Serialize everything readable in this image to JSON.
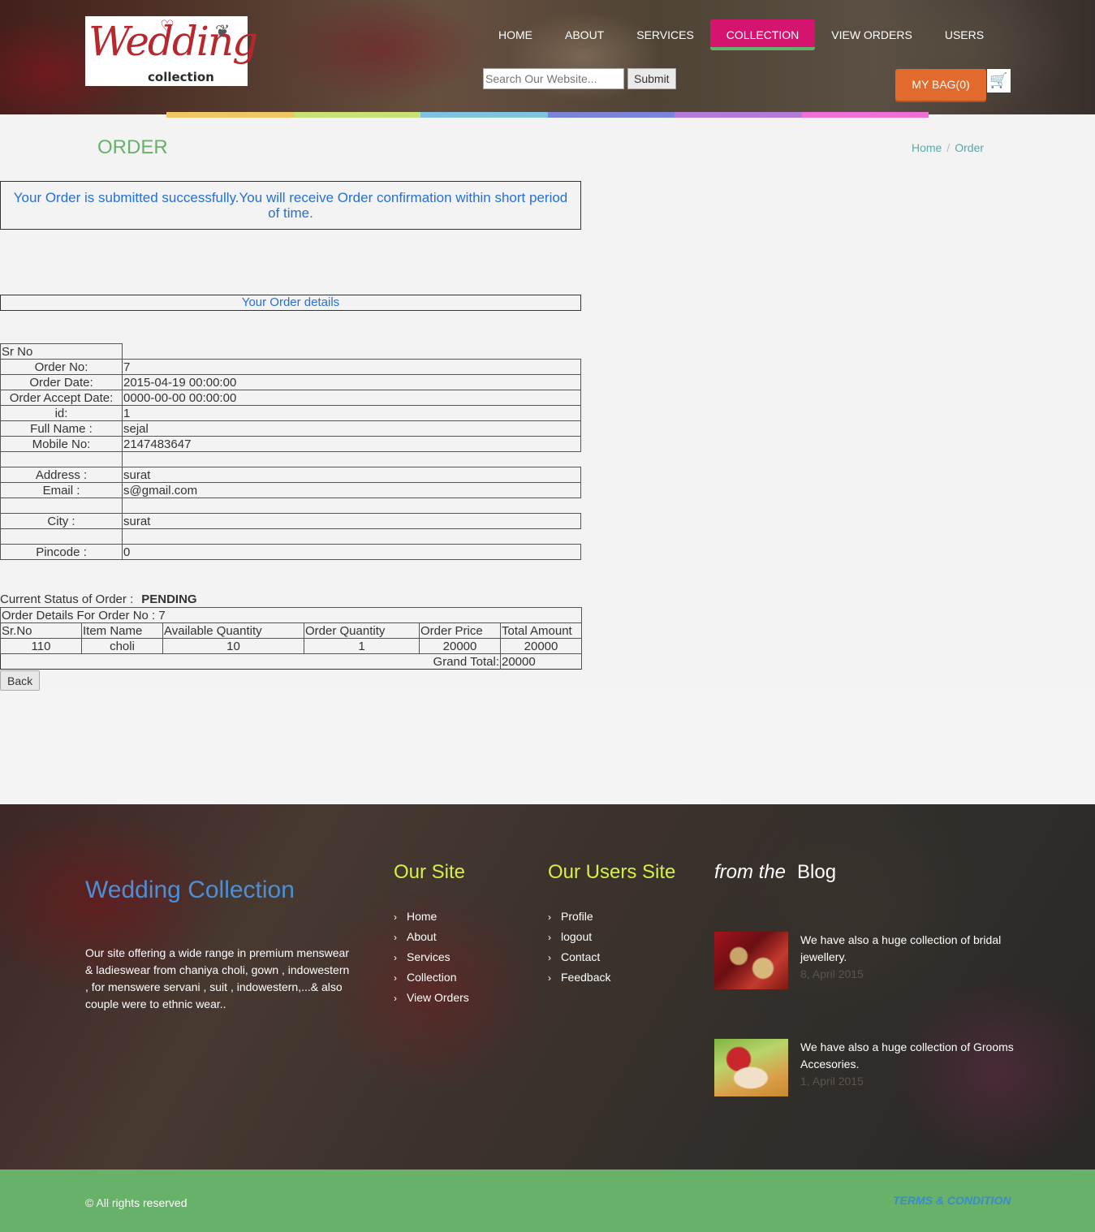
{
  "logo": {
    "script_text": "Wedding",
    "sub_text": "collection"
  },
  "nav": {
    "items": [
      {
        "label": "HOME"
      },
      {
        "label": "ABOUT"
      },
      {
        "label": "SERVICES"
      },
      {
        "label": "COLLECTION",
        "active": true
      },
      {
        "label": "VIEW ORDERS"
      },
      {
        "label": "USERS"
      }
    ]
  },
  "search": {
    "placeholder": "Search Our Website...",
    "submit_label": "Submit"
  },
  "bag": {
    "label": "MY BAG(0)"
  },
  "colorbar": [
    "#f1c765",
    "#c9e277",
    "#7fc3e1",
    "#7b85d8",
    "#b57ad8",
    "#ee6fd6"
  ],
  "page": {
    "title": "ORDER",
    "breadcrumb": [
      "Home",
      "Order"
    ]
  },
  "success_message": "Your Order is submitted successfully.You will receive Order confirmation within short period of time.",
  "details_title": "Your Order details",
  "info": {
    "header": "Sr No",
    "rows": [
      {
        "label": "Order No:",
        "value": "7"
      },
      {
        "label": "Order Date:",
        "value": "2015-04-19 00:00:00"
      },
      {
        "label": "Order Accept Date:",
        "value": "0000-00-00 00:00:00"
      },
      {
        "label": "id:",
        "value": "1"
      },
      {
        "label": "Full Name :",
        "value": "sejal"
      },
      {
        "label": "Mobile No:",
        "value": "2147483647"
      },
      {
        "label": "",
        "value": ""
      },
      {
        "label": "Address :",
        "value": "surat"
      },
      {
        "label": "Email :",
        "value": "s@gmail.com"
      },
      {
        "label": "",
        "value": ""
      },
      {
        "label": "City :",
        "value": "surat"
      },
      {
        "label": "",
        "value": ""
      },
      {
        "label": "Pincode :",
        "value": "0"
      }
    ]
  },
  "status": {
    "label": "Current Status of Order :",
    "value": "PENDING"
  },
  "order_details": {
    "title": "Order Details For Order No : 7",
    "columns": [
      "Sr.No",
      "Item Name",
      "Available Quantity",
      "Order Quantity",
      "Order Price",
      "Total Amount"
    ],
    "rows": [
      [
        "110",
        "choli",
        "10",
        "1",
        "20000",
        "20000"
      ]
    ],
    "grand_total_label": "Grand Total:",
    "grand_total_value": "20000"
  },
  "back_label": "Back",
  "footer": {
    "brand": "Wedding Collection",
    "description": "Our site offering a wide range in premium menswear & ladieswear from chaniya choli, gown , indowestern , for menswere servani , suit , indowestern,...& also couple were to ethnic wear..",
    "our_site": {
      "title": "Our Site",
      "links": [
        "Home",
        "About",
        "Services",
        "Collection",
        "View Orders"
      ]
    },
    "users_site": {
      "title": "Our Users Site",
      "links": [
        "Profile",
        "logout",
        "Contact",
        "Feedback"
      ]
    },
    "blog": {
      "title_italic": "from the",
      "title_main": "Blog",
      "posts": [
        {
          "text": "We have also a huge collection of bridal jewellery.",
          "date": "8, April 2015"
        },
        {
          "text": "We have also a huge collection of Grooms Accesories.",
          "date": "1, April 2015"
        }
      ]
    }
  },
  "bottom": {
    "copyright": "© All rights reserved",
    "terms": "TERMS & CONDITION"
  }
}
